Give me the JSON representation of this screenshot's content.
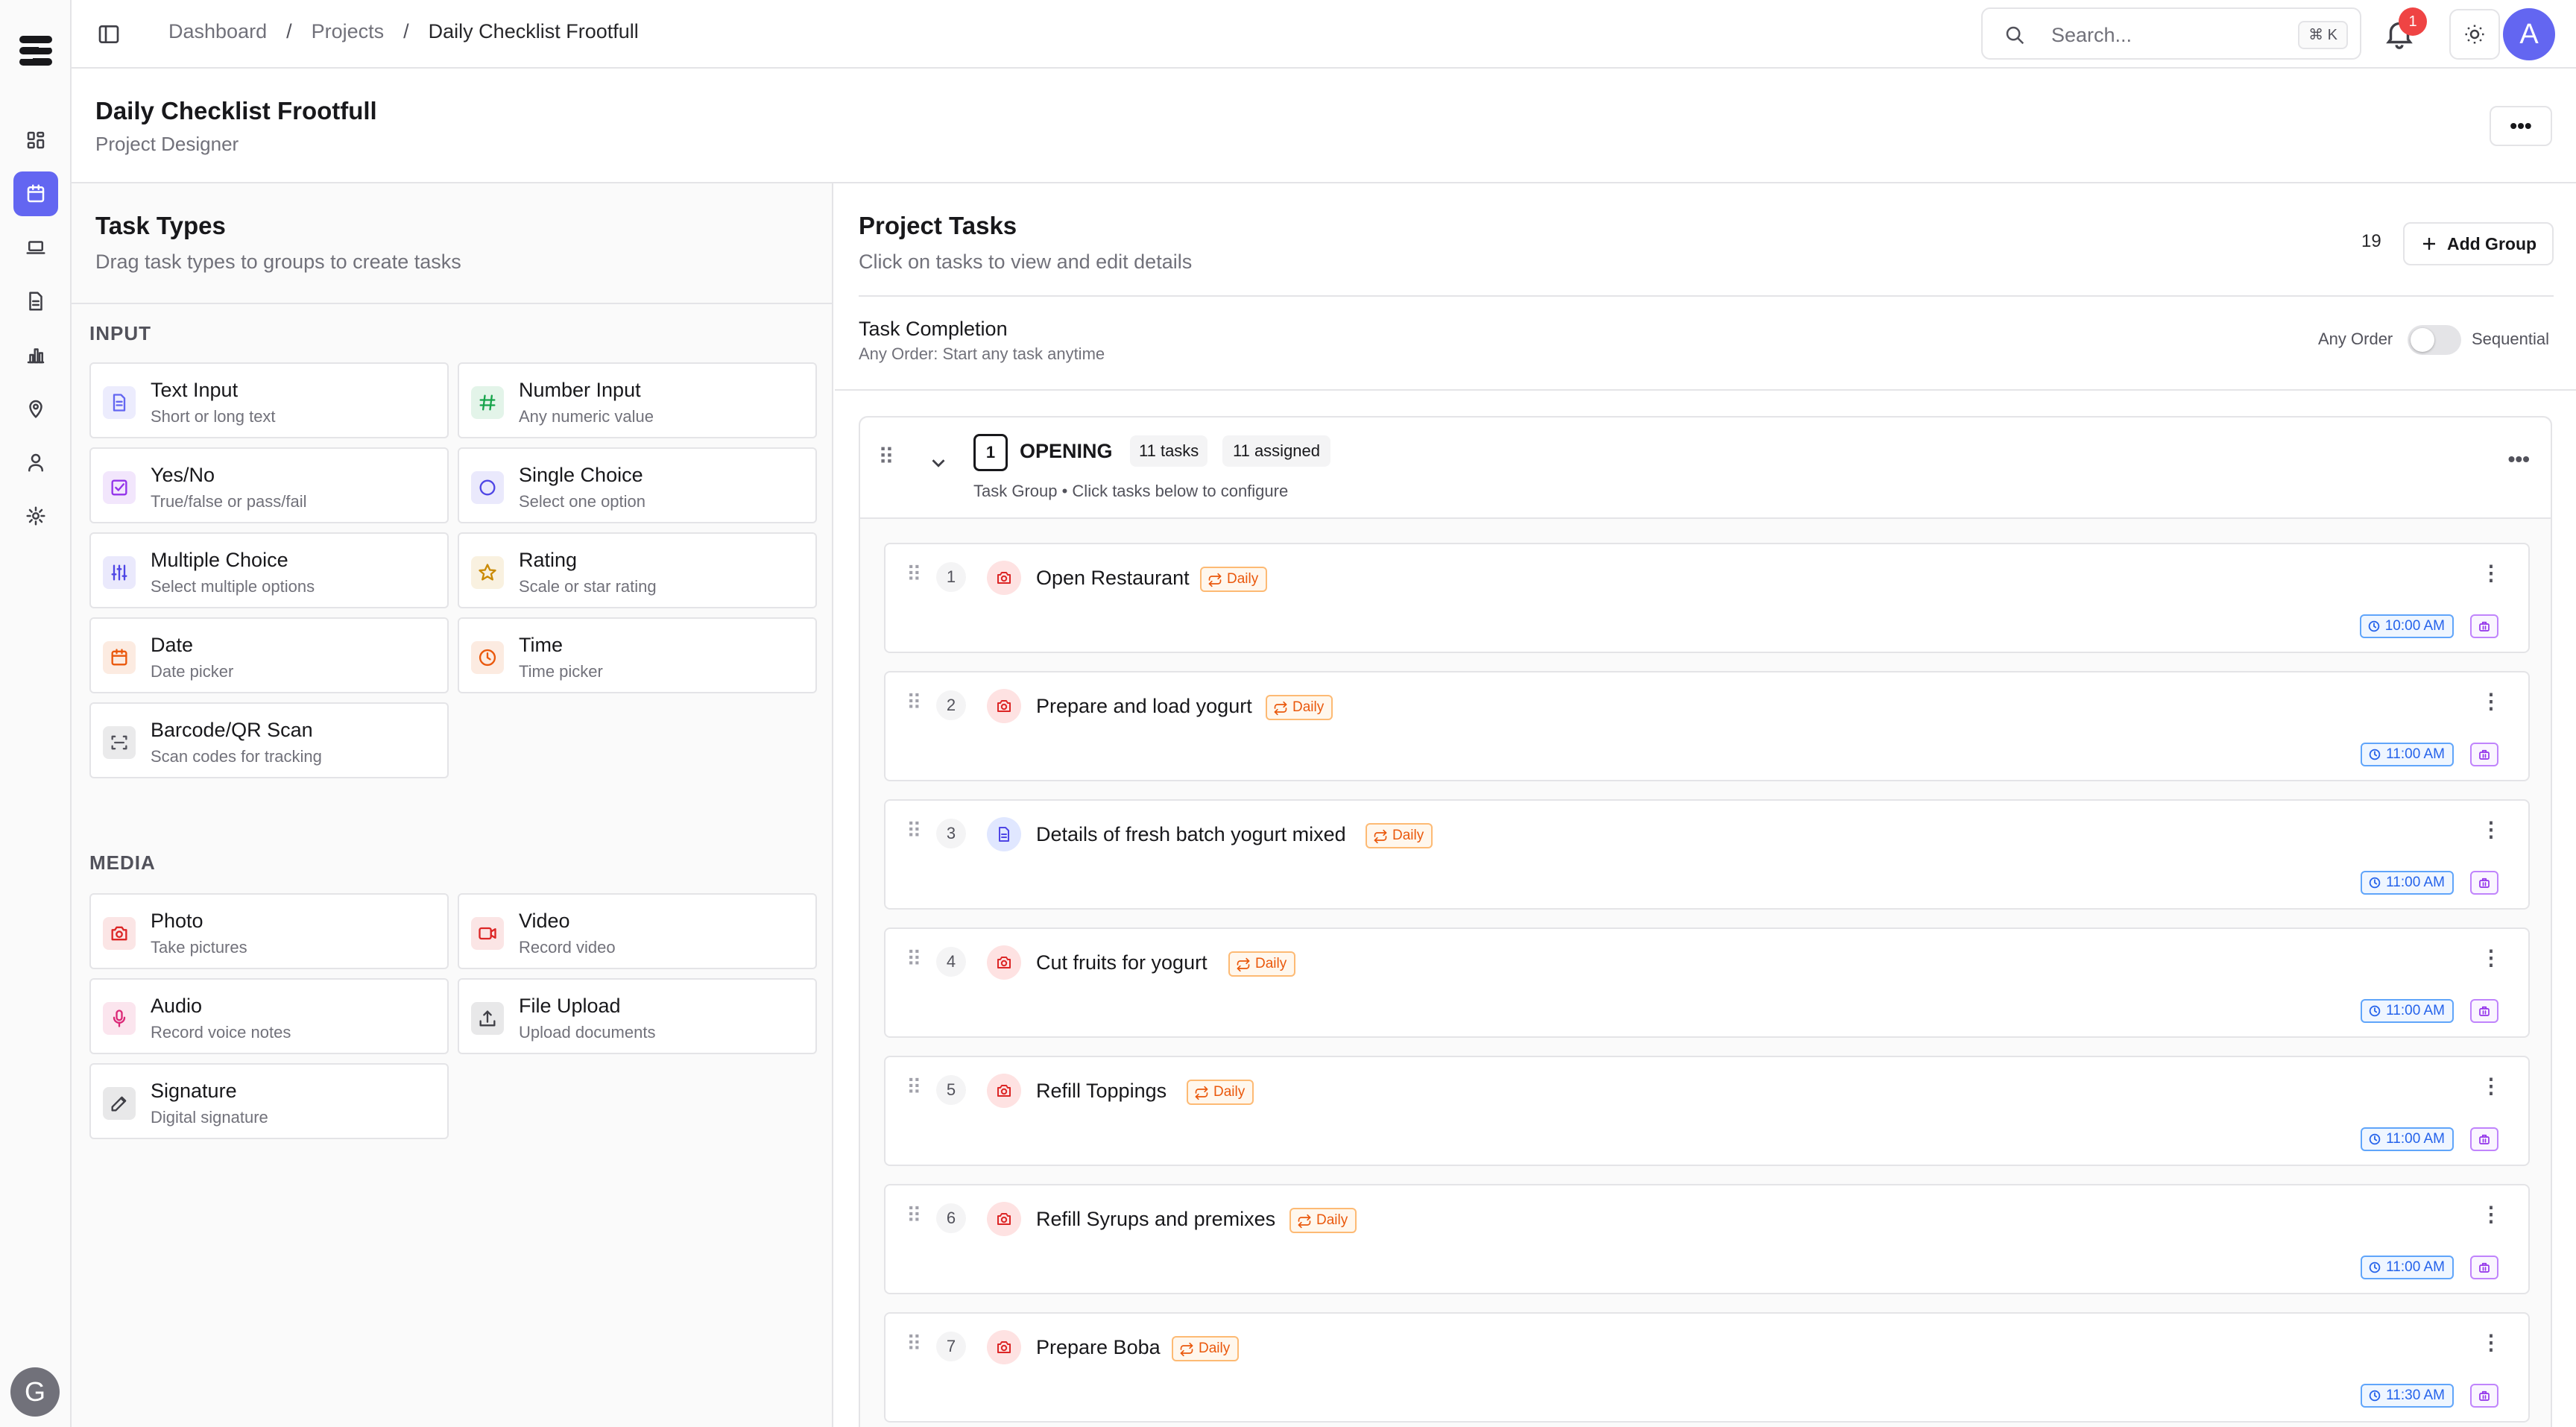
{
  "breadcrumbs": [
    "Dashboard",
    "Projects",
    "Daily Checklist Frootfull"
  ],
  "search": {
    "placeholder": "Search...",
    "shortcut": "⌘ K"
  },
  "notifications": {
    "count": "1"
  },
  "user": {
    "initial": "A"
  },
  "rail_user": {
    "initial": "G"
  },
  "rail_items": [
    "dashboard-icon",
    "calendar-icon",
    "laptop-icon",
    "document-icon",
    "chart-icon",
    "location-icon",
    "user-icon",
    "settings-icon"
  ],
  "page": {
    "title": "Daily Checklist Frootfull",
    "subtitle": "Project Designer",
    "more": "•••"
  },
  "task_types": {
    "title": "Task Types",
    "subtitle": "Drag task types to groups to create tasks",
    "sections": [
      {
        "label": "INPUT",
        "items": [
          {
            "name": "Text Input",
            "desc": "Short or long text",
            "icon": "text-icon",
            "color": "#6366f1"
          },
          {
            "name": "Number Input",
            "desc": "Any numeric value",
            "icon": "hash-icon",
            "color": "#16a34a"
          },
          {
            "name": "Yes/No",
            "desc": "True/false or pass/fail",
            "icon": "checkbox-icon",
            "color": "#9333ea"
          },
          {
            "name": "Single Choice",
            "desc": "Select one option",
            "icon": "circle-icon",
            "color": "#4f46e5"
          },
          {
            "name": "Multiple Choice",
            "desc": "Select multiple options",
            "icon": "sliders-icon",
            "color": "#4f46e5"
          },
          {
            "name": "Rating",
            "desc": "Scale or star rating",
            "icon": "star-icon",
            "color": "#ca8a04"
          },
          {
            "name": "Date",
            "desc": "Date picker",
            "icon": "calendar-icon",
            "color": "#ea580c"
          },
          {
            "name": "Time",
            "desc": "Time picker",
            "icon": "clock-icon",
            "color": "#ea580c"
          },
          {
            "name": "Barcode/QR Scan",
            "desc": "Scan codes for tracking",
            "icon": "scan-icon",
            "color": "#52525b"
          }
        ]
      },
      {
        "label": "MEDIA",
        "items": [
          {
            "name": "Photo",
            "desc": "Take pictures",
            "icon": "camera-icon",
            "color": "#dc2626"
          },
          {
            "name": "Video",
            "desc": "Record video",
            "icon": "video-icon",
            "color": "#dc2626"
          },
          {
            "name": "Audio",
            "desc": "Record voice notes",
            "icon": "mic-icon",
            "color": "#db2777"
          },
          {
            "name": "File Upload",
            "desc": "Upload documents",
            "icon": "upload-icon",
            "color": "#3f3f46"
          },
          {
            "name": "Signature",
            "desc": "Digital signature",
            "icon": "pen-icon",
            "color": "#3f3f46"
          }
        ]
      }
    ]
  },
  "project_tasks": {
    "title": "Project Tasks",
    "subtitle": "Click on tasks to view and edit details",
    "count": "19",
    "add_group": "Add Group",
    "completion_title": "Task Completion",
    "completion_sub": "Any Order: Start any task anytime",
    "order_any": "Any Order",
    "order_seq": "Sequential",
    "sequential_enabled": false
  },
  "group": {
    "number": "1",
    "name": "OPENING",
    "tasks": "11 tasks",
    "assigned": "11 assigned",
    "subtitle": "Task Group • Click tasks below to configure"
  },
  "tasks": [
    {
      "num": "1",
      "name": "Open Restaurant",
      "badge": "Daily",
      "time": "10:00 AM",
      "icon": "camera-icon"
    },
    {
      "num": "2",
      "name": "Prepare and load yogurt",
      "badge": "Daily",
      "time": "11:00 AM",
      "icon": "camera-icon"
    },
    {
      "num": "3",
      "name": "Details of fresh batch yogurt mixed",
      "badge": "Daily",
      "time": "11:00 AM",
      "icon": "document-icon"
    },
    {
      "num": "4",
      "name": "Cut fruits for yogurt",
      "badge": "Daily",
      "time": "11:00 AM",
      "icon": "camera-icon"
    },
    {
      "num": "5",
      "name": "Refill Toppings",
      "badge": "Daily",
      "time": "11:00 AM",
      "icon": "camera-icon"
    },
    {
      "num": "6",
      "name": "Refill Syrups and premixes",
      "badge": "Daily",
      "time": "11:00 AM",
      "icon": "camera-icon"
    },
    {
      "num": "7",
      "name": "Prepare Boba",
      "badge": "Daily",
      "time": "11:30 AM",
      "icon": "camera-icon"
    }
  ]
}
